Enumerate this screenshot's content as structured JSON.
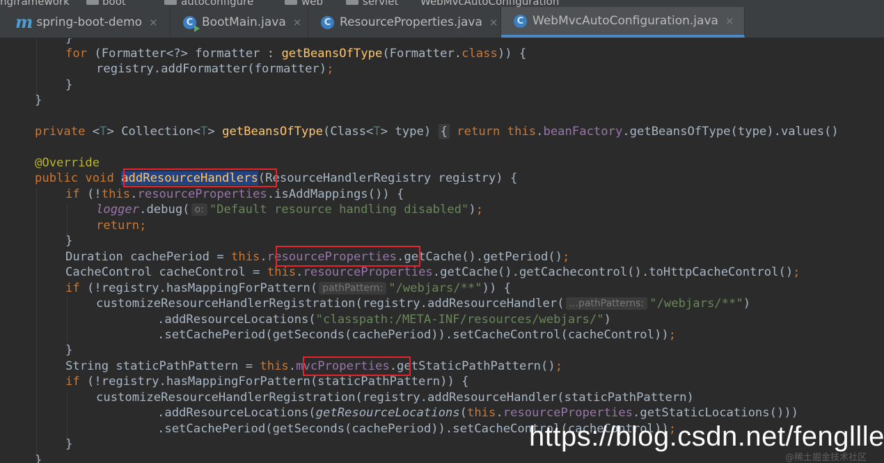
{
  "breadcrumb": {
    "items": [
      "ngframework",
      "boot",
      "autoconfigure",
      "web",
      "servlet",
      "WebMvcAutoConfiguration"
    ]
  },
  "tabs": [
    {
      "label": "spring-boot-demo",
      "icon": "maven-module-icon",
      "active": false
    },
    {
      "label": "BootMain.java",
      "icon": "runnable-class-icon",
      "active": false
    },
    {
      "label": "ResourceProperties.java",
      "icon": "class-icon",
      "active": false
    },
    {
      "label": "WebMvcAutoConfiguration.java",
      "icon": "class-icon",
      "active": true
    }
  ],
  "tab_close_glyph": "×",
  "code": {
    "l01_brace": "}",
    "l02_for": "for",
    "l02_a": " (Formatter<?> formatter : ",
    "l02_fn": "getBeansOfType",
    "l02_b": "(Formatter.",
    "l02_class": "class",
    "l02_c": ")) {",
    "l03_a": "registry.addFormatter(formatter)",
    "l03_semi": ";",
    "l04_brace": "}",
    "l05_brace": "}",
    "l07_private": "private",
    "l07_lt": " <",
    "l07_t1": "T",
    "l07_gt": "> Collection<",
    "l07_t2": "T",
    "l07_gt2": "> ",
    "l07_fn": "getBeansOfType",
    "l07_args": "(Class<",
    "l07_t3": "T",
    "l07_args2": "> type) ",
    "l07_fold": "{",
    "l07_return": " return ",
    "l07_this": "this",
    "l07_dot": ".",
    "l07_fld": "beanFactory",
    "l07_rest": ".getBeansOfType(type).values()",
    "l09_ann": "@Override",
    "l10_public": "public void",
    "l10_sp": " ",
    "l10_fn": "addResourceHandlers",
    "l10_rest": "(ResourceHandlerRegistry registry) {",
    "l11_if": "if",
    "l11_a": " (!",
    "l11_this": "this",
    "l11_dot": ".",
    "l11_fld": "resourceProperties",
    "l11_rest": ".isAddMappings()) {",
    "l12_logger": "logger",
    "l12_a": ".debug(",
    "l12_hint": "o:",
    "l12_str": "\"Default resource handling disabled\"",
    "l12_b": ")",
    "l12_semi": ";",
    "l13_return": "return;",
    "l14_brace": "}",
    "l15_a": "Duration cachePeriod = ",
    "l15_this": "this",
    "l15_dot": ".",
    "l15_fld": "resourceProperties",
    "l15_rest": ".getCache().getPeriod()",
    "l15_semi": ";",
    "l16_a": "CacheControl cacheControl = ",
    "l16_this": "this",
    "l16_dot": ".",
    "l16_fld": "resourceProperties",
    "l16_rest": ".getCache().getCachecontrol().toHttpCacheControl()",
    "l16_semi": ";",
    "l17_if": "if",
    "l17_a": " (!registry.hasMappingForPattern(",
    "l17_hint": "pathPattern:",
    "l17_str": "\"/webjars/**\"",
    "l17_b": ")) {",
    "l18_a": "customizeResourceHandlerRegistration(registry.addResourceHandler(",
    "l18_hint": "...pathPatterns:",
    "l18_str": "\"/webjars/**\"",
    "l18_b": ")",
    "l19_a": ".addResourceLocations(",
    "l19_str": "\"classpath:/META-INF/resources/webjars/\"",
    "l19_b": ")",
    "l20_a": ".setCachePeriod(getSeconds(cachePeriod)).setCacheControl(cacheControl))",
    "l20_semi": ";",
    "l21_brace": "}",
    "l22_a": "String staticPathPattern = ",
    "l22_this": "this",
    "l22_dot": ".",
    "l22_fld": "mvcProperties",
    "l22_rest": ".getStaticPathPattern()",
    "l22_semi": ";",
    "l23_if": "if",
    "l23_a": " (!registry.hasMappingForPattern(staticPathPattern)) {",
    "l24_a": "customizeResourceHandlerRegistration(registry.addResourceHandler(staticPathPattern)",
    "l25_a": ".addResourceLocations(",
    "l25_it": "getResourceLocations",
    "l25_b": "(",
    "l25_this": "this",
    "l25_dot": ".",
    "l25_fld": "resourceProperties",
    "l25_rest": ".getStaticLocations()))",
    "l26_a": ".setCachePeriod(getSeconds(cachePeriod)).setCacheControl(cacheControl))",
    "l26_semi": ";",
    "l27_brace": "}",
    "l28_brace": "}"
  },
  "watermark": {
    "main": "https://blog.csdn.net/fengllle",
    "small": "@稀土掘金技术社区"
  },
  "colors": {
    "background": "#2b2b2b",
    "keyword": "#cc7832",
    "method": "#ffc66d",
    "field": "#9876aa",
    "string": "#6a8759",
    "annotation": "#bbb529",
    "highlight_box": "#e8232b",
    "selection": "#214283"
  }
}
